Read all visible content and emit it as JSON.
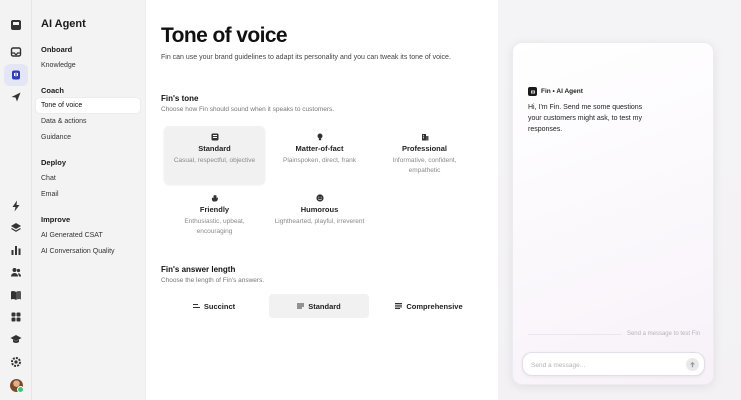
{
  "rail": {
    "icons": [
      "inbox-icon",
      "fin-icon",
      "outbound-icon",
      "bolt-icon",
      "layers-icon",
      "reports-icon",
      "contacts-icon",
      "knowledge-book-icon",
      "apps-icon",
      "academy-icon",
      "settings-icon"
    ],
    "active": "fin-icon"
  },
  "sidebar": {
    "title": "AI Agent",
    "sections": [
      {
        "label": "Onboard",
        "items": [
          {
            "label": "Knowledge"
          }
        ]
      },
      {
        "label": "Coach",
        "items": [
          {
            "label": "Tone of voice",
            "selected": true
          },
          {
            "label": "Data & actions"
          },
          {
            "label": "Guidance"
          }
        ]
      },
      {
        "label": "Deploy",
        "items": [
          {
            "label": "Chat"
          },
          {
            "label": "Email"
          }
        ]
      },
      {
        "label": "Improve",
        "items": [
          {
            "label": "AI Generated CSAT"
          },
          {
            "label": "AI Conversation Quality"
          }
        ]
      }
    ]
  },
  "main": {
    "title": "Tone of voice",
    "description": "Fin can use your brand guidelines to adapt its personality and you can tweak its tone of voice.",
    "tone": {
      "title": "Fin's tone",
      "description": "Choose how Fin should sound when it speaks to customers.",
      "options": [
        {
          "name": "Standard",
          "desc": "Casual, respectful, objective",
          "icon": "badge-icon",
          "selected": true
        },
        {
          "name": "Matter-of-fact",
          "desc": "Plainspoken, direct, frank",
          "icon": "lightbulb-icon"
        },
        {
          "name": "Professional",
          "desc": "Informative, confident, empathetic",
          "icon": "building-icon"
        },
        {
          "name": "Friendly",
          "desc": "Enthusiastic, upbeat, encouraging",
          "icon": "wave-hand-icon"
        },
        {
          "name": "Humorous",
          "desc": "Lighthearted, playful, irreverent",
          "icon": "smile-icon"
        }
      ]
    },
    "length": {
      "title": "Fin's answer length",
      "description": "Choose the length of Fin's answers.",
      "options": [
        {
          "label": "Succinct",
          "icon": "short-lines-icon"
        },
        {
          "label": "Standard",
          "icon": "medium-lines-icon",
          "selected": true
        },
        {
          "label": "Comprehensive",
          "icon": "long-lines-icon"
        }
      ]
    }
  },
  "preview": {
    "sender": "Fin • AI Agent",
    "message": "Hi, I'm Fin. Send me some questions your customers might ask, to test my responses.",
    "hint": "Send a message to test Fin",
    "input_placeholder": "Send a message..."
  },
  "colors": {
    "rail_active_bg": "#e3e6f5",
    "selected_card_bg": "#f1f1f2",
    "accent": "#2f3cc4"
  }
}
